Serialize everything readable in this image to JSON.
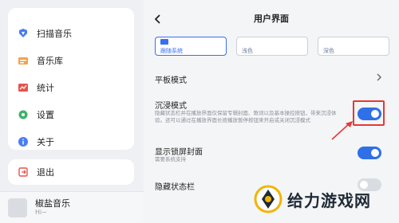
{
  "sidebar": {
    "items": [
      {
        "label": "扫描音乐",
        "icon": "scan-music-icon"
      },
      {
        "label": "音乐库",
        "icon": "music-library-icon"
      },
      {
        "label": "统计",
        "icon": "statistics-icon"
      },
      {
        "label": "设置",
        "icon": "settings-icon"
      },
      {
        "label": "关于",
        "icon": "info-icon"
      }
    ],
    "exit": {
      "label": "退出",
      "icon": "exit-icon"
    }
  },
  "player": {
    "title": "椒盐音乐",
    "subtitle": "Hi~"
  },
  "page": {
    "title": "用户界面",
    "themes": [
      {
        "label": "跟随系统",
        "selected": true
      },
      {
        "label": "浅色",
        "selected": false
      },
      {
        "label": "深色",
        "selected": false
      }
    ],
    "settings": [
      {
        "label": "平板模式",
        "type": "link"
      },
      {
        "label": "沉浸模式",
        "description": "隐藏状态栏并在播放界面仅保留专辑封面、歌词以及基本操控按钮，带来沉浸体验。还可以通过在播放界面长按播放暂停按钮来开启或关闭沉浸模式",
        "enabled": true
      },
      {
        "label": "显示锁屏封面",
        "description": "需要系统支持",
        "enabled": true
      },
      {
        "label": "隐藏状态栏",
        "enabled": false
      }
    ]
  },
  "watermark": {
    "text": "给力游戏网"
  },
  "colors": {
    "accent": "#2f6fe8",
    "annotation": "#e53935"
  }
}
